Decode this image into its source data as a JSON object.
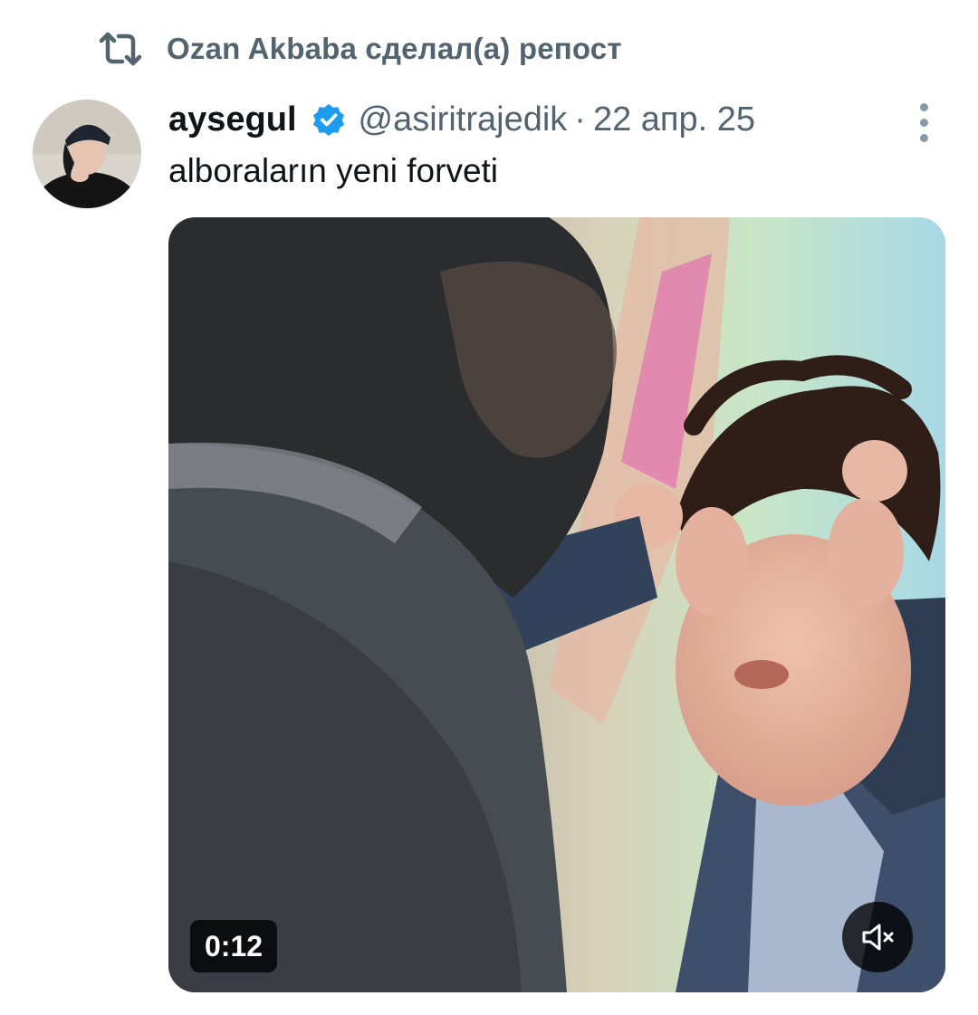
{
  "repost": {
    "icon": "repost-icon",
    "text": "Ozan Akbaba сделал(а) репост"
  },
  "tweet": {
    "author": {
      "display_name": "aysegul",
      "handle": "@asiritrajedik",
      "verified": true,
      "verified_icon": "verified-badge-icon",
      "avatar": "avatar-image"
    },
    "separator": "·",
    "timestamp": "22 апр. 25",
    "more_icon": "more-vertical-icon",
    "text": "alboraların yeni forveti",
    "media": {
      "type": "video",
      "duration": "0:12",
      "muted": true,
      "mute_icon": "speaker-muted-icon"
    }
  },
  "colors": {
    "text_primary": "#0f1419",
    "text_secondary": "#536471",
    "verified_blue": "#1d9bf0",
    "overlay": "#000000"
  }
}
